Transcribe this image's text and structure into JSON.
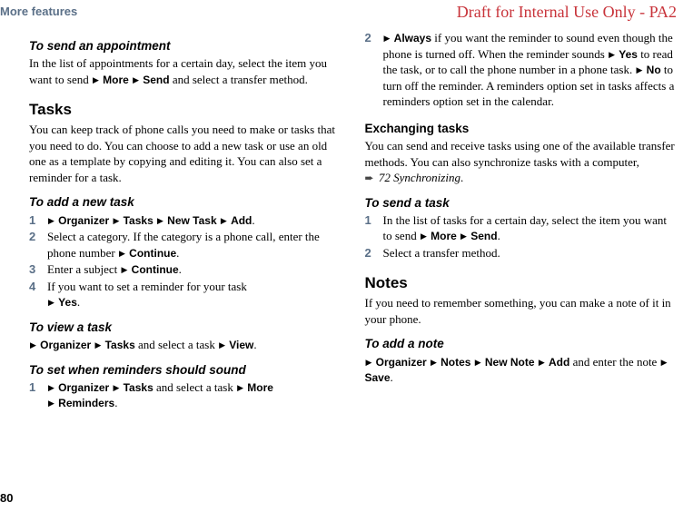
{
  "header": {
    "section": "More features",
    "watermark": "Draft for Internal Use Only - PA2"
  },
  "page_number": "80",
  "left": {
    "send_appt": {
      "heading": "To send an appointment",
      "body_a": "In the list of appointments for a certain day, select the item you want to send ",
      "menu1": "More",
      "menu2": "Send",
      "body_b": " and select a transfer method."
    },
    "tasks": {
      "heading": "Tasks",
      "body": "You can keep track of phone calls you need to make or tasks that you need to do. You can choose to add a new task or use an old one as a template by copying and editing it. You can also set a reminder for a task."
    },
    "add_task": {
      "heading": "To add a new task",
      "s1_menu": {
        "a": "Organizer",
        "b": "Tasks",
        "c": "New Task",
        "d": "Add"
      },
      "s2_a": "Select a category. If the category is a phone call, enter the phone number ",
      "s2_menu": "Continue",
      "s3_a": "Enter a subject ",
      "s3_menu": "Continue",
      "s4_a": "If you want to set a reminder for your task ",
      "s4_menu": "Yes"
    },
    "view_task": {
      "heading": "To view a task",
      "menu_a": "Organizer",
      "menu_b": "Tasks",
      "mid": " and select a task ",
      "menu_c": "View"
    },
    "set_reminders": {
      "heading": "To set when reminders should sound",
      "s1_a": "Organizer",
      "s1_b": "Tasks",
      "s1_mid": " and select a task ",
      "s1_c": "More",
      "s1_d": "Reminders"
    }
  },
  "right": {
    "step2": {
      "a": "Always",
      "body_a": " if you want the reminder to sound even though the phone is turned off. When the reminder sounds ",
      "b": "Yes",
      "body_b": " to read the task, or to call the phone number in a phone task. ",
      "c": "No",
      "body_c": " to turn off the reminder. A reminders option set in tasks affects a reminders option set in the calendar."
    },
    "exchanging": {
      "heading": "Exchanging tasks",
      "body": "You can send and receive tasks using one of the available transfer methods. You can also synchronize tasks with a computer,",
      "xref": "72 Synchronizing"
    },
    "send_task": {
      "heading": "To send a task",
      "s1_a": "In the list of tasks for a certain day, select the item you want to send ",
      "s1_m1": "More",
      "s1_m2": "Send",
      "s2": "Select a transfer method."
    },
    "notes": {
      "heading": "Notes",
      "body": "If you need to remember something, you can make a note of it in your phone."
    },
    "add_note": {
      "heading": "To add a note",
      "m1": "Organizer",
      "m2": "Notes",
      "m3": "New Note",
      "m4": "Add",
      "mid": " and enter the note ",
      "m5": "Save"
    }
  },
  "steps": {
    "n1": "1",
    "n2": "2",
    "n3": "3",
    "n4": "4"
  }
}
